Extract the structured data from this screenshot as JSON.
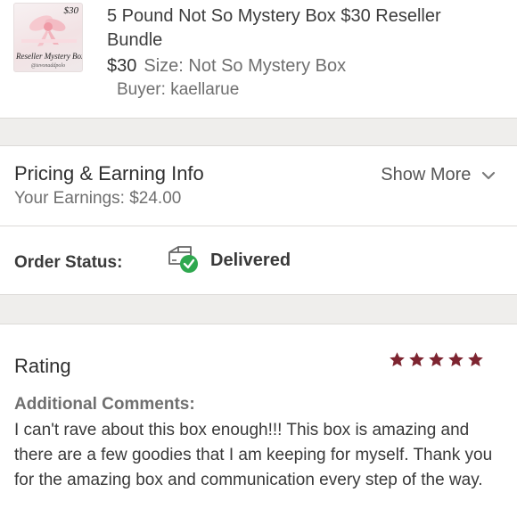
{
  "item": {
    "thumbnail": {
      "price_tag": "$30",
      "caption": "Reseller Mystery Box",
      "handle": "@tevonaddpolo"
    },
    "title": "5 Pound Not So Mystery Box $30 Reseller Bundle",
    "price": "$30",
    "size": "Size: Not So Mystery Box",
    "buyer": "Buyer: kaellarue"
  },
  "pricing": {
    "title": "Pricing & Earning Info",
    "earnings": "Your Earnings: $24.00",
    "show_more": "Show More"
  },
  "order_status": {
    "label": "Order Status:",
    "value": "Delivered",
    "icon": "delivered-box-icon"
  },
  "rating": {
    "title": "Rating",
    "stars": 5,
    "max_stars": 5,
    "star_color": "#7d2430",
    "comments_label": "Additional Comments:",
    "comments": "I can't rave about this box enough!!! This box is amazing and there are a few goodies that I am keeping for myself. Thank you for the amazing box and communication every step of the way."
  },
  "colors": {
    "accent_star": "#7d2430",
    "check_green": "#2fa84f",
    "section_gap": "#efeeec"
  }
}
